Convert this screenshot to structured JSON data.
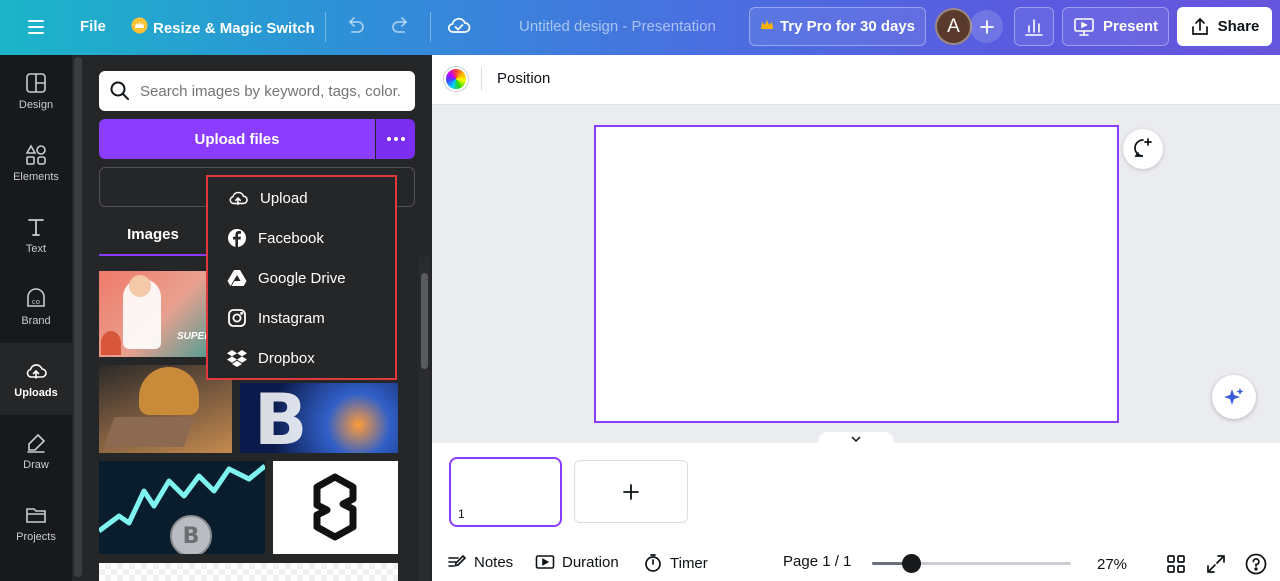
{
  "topbar": {
    "file_label": "File",
    "resize_label": "Resize & Magic Switch",
    "title": "Untitled design - Presentation",
    "pro_label": "Try Pro for 30 days",
    "avatar_initial": "A",
    "present_label": "Present",
    "share_label": "Share"
  },
  "rail": [
    {
      "label": "Design",
      "icon": "design-icon"
    },
    {
      "label": "Elements",
      "icon": "elements-icon"
    },
    {
      "label": "Text",
      "icon": "text-icon"
    },
    {
      "label": "Brand",
      "icon": "brand-icon"
    },
    {
      "label": "Uploads",
      "icon": "uploads-icon",
      "active": true
    },
    {
      "label": "Draw",
      "icon": "draw-icon"
    },
    {
      "label": "Projects",
      "icon": "projects-icon"
    }
  ],
  "panel": {
    "search_placeholder": "Search images by keyword, tags, color...",
    "upload_label": "Upload files",
    "tab_images": "Images"
  },
  "dropdown": [
    {
      "label": "Upload",
      "icon": "cloud-upload-icon"
    },
    {
      "label": "Facebook",
      "icon": "facebook-icon"
    },
    {
      "label": "Google Drive",
      "icon": "google-drive-icon"
    },
    {
      "label": "Instagram",
      "icon": "instagram-icon"
    },
    {
      "label": "Dropbox",
      "icon": "dropbox-icon"
    }
  ],
  "thumb_texts": {
    "super": "SUPER",
    "bitcoin_letter": "B"
  },
  "editor": {
    "position_label": "Position",
    "page_number": "1"
  },
  "footer": {
    "notes": "Notes",
    "duration": "Duration",
    "timer": "Timer",
    "page_indicator": "Page 1 / 1",
    "zoom": "27%",
    "zoom_value": 0.2
  },
  "colors": {
    "accent": "#8b3dff",
    "highlight": "#e0393e"
  }
}
